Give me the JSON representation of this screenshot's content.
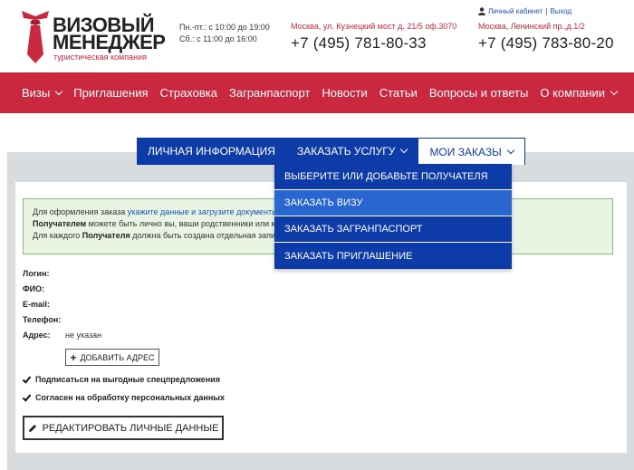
{
  "header": {
    "logo": {
      "line1": "ВИЗОВЫЙ",
      "line2": "МЕНЕДЖЕР",
      "subtitle": "туристическая компания"
    },
    "hours": {
      "weekdays": "Пн.-пт.: с 10:00 до 19:00",
      "saturday": "Сб.: с 11:00 до 16:00"
    },
    "office1": {
      "address": "Москва, ул. Кузнецкий мост д. 21/5 оф.3070",
      "phone": "+7 (495) 781-80-33"
    },
    "office2": {
      "address": "Москва, Ленинский пр.,д.1/2",
      "phone": "+7 (495) 783-80-20"
    },
    "account": {
      "cabinet": "Личный кабинет",
      "separator": "|",
      "logout": "Выход"
    }
  },
  "nav": {
    "items": [
      "Визы",
      "Приглашения",
      "Страховка",
      "Загранпаспорт",
      "Новости",
      "Статьи",
      "Вопросы и ответы",
      "О компании"
    ]
  },
  "tabs": [
    {
      "label": "ЛИЧНАЯ ИНФОРМАЦИЯ"
    },
    {
      "label": "ЗАКАЗАТЬ УСЛУГУ"
    },
    {
      "label": "МОИ ЗАКАЗЫ"
    }
  ],
  "dropdown": {
    "items": [
      "ВЫБЕРИТЕ ИЛИ ДОБАВЬТЕ ПОЛУЧАТЕЛЯ",
      "ЗАКАЗАТЬ ВИЗУ",
      "ЗАКАЗАТЬ ЗАГРАНПАСПОРТ",
      "ЗАКАЗАТЬ ПРИГЛАШЕНИЕ"
    ]
  },
  "notice": {
    "line1_prefix": "Для оформления заказа ",
    "line1_link": "укажите данные и загрузите документы",
    "line2_bold": "Получателем",
    "line2_rest": " можете быть лично вы, ваши родственники или кли",
    "line3_prefix": "Для каждого ",
    "line3_bold": "Получателя",
    "line3_rest": " должна быть создана отдельная запись"
  },
  "profile": {
    "login_label": "Логин:",
    "fio_label": "ФИО:",
    "email_label": "E-mail:",
    "phone_label": "Телефон:",
    "address_label": "Адрес:",
    "address_value": "не указан"
  },
  "buttons": {
    "add_address": "ДОБАВИТЬ АДРЕС",
    "edit_personal": "РЕДАКТИРОВАТЬ ЛИЧНЫЕ ДАННЫЕ"
  },
  "checkboxes": {
    "subscribe": {
      "label": "Подписаться на выгодные спецпредложения",
      "checked": true
    },
    "consent": {
      "label": "Согласен на обработку персональных данных",
      "checked": true
    }
  },
  "colors": {
    "brand_red": "#c9283e",
    "tab_blue": "#0d3ba8",
    "dropdown_hover": "#2a66d0"
  }
}
